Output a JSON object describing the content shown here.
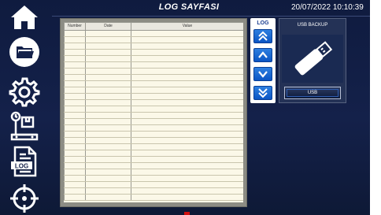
{
  "header": {
    "title": "LOG SAYFASI",
    "datetime": "20/07/2022 10:10:39"
  },
  "sidebar": {
    "items": [
      {
        "name": "home",
        "icon": "home-icon"
      },
      {
        "name": "folder",
        "icon": "folder-icon"
      },
      {
        "name": "settings",
        "icon": "gear-icon"
      },
      {
        "name": "weighing",
        "icon": "scale-icon"
      },
      {
        "name": "log",
        "icon": "log-document-icon",
        "label": "LOG"
      },
      {
        "name": "target",
        "icon": "crosshair-icon"
      }
    ]
  },
  "log_table": {
    "columns": [
      "Number",
      "Date",
      "Value"
    ],
    "rows": []
  },
  "log_nav": {
    "label": "LOG",
    "buttons": [
      "page-up",
      "row-up",
      "row-down",
      "page-down"
    ]
  },
  "usb": {
    "title": "USB BACKUP",
    "button_label": "USB",
    "icon": "usb-drive-icon"
  },
  "colors": {
    "background": "#14214a",
    "accent_blue": "#0a55c4",
    "table_bg": "#fbf8e8"
  }
}
